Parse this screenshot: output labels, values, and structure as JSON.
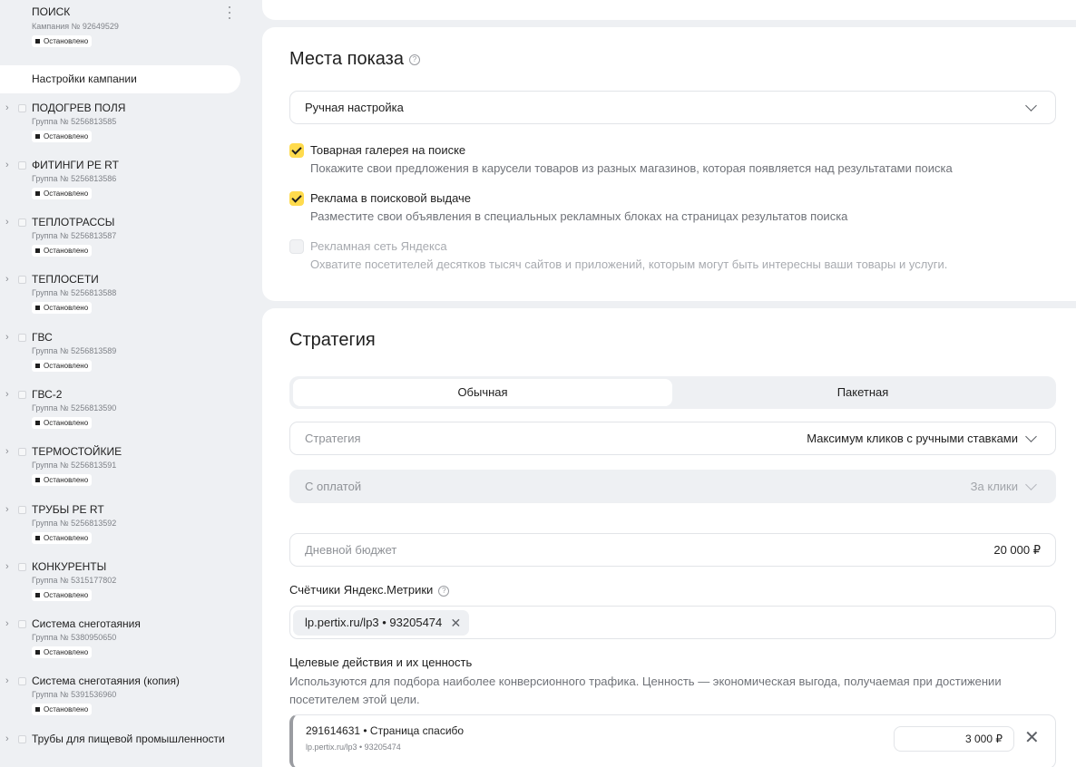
{
  "sidebar": {
    "campaign": {
      "title": "ПОИСК",
      "subtitle": "Кампания № 92649529",
      "status": "Остановлено"
    },
    "settings_label": "Настройки кампании",
    "groups": [
      {
        "title": "ПОДОГРЕВ ПОЛЯ",
        "subtitle": "Группа № 5256813585",
        "status": "Остановлено"
      },
      {
        "title": "ФИТИНГИ PE RT",
        "subtitle": "Группа № 5256813586",
        "status": "Остановлено"
      },
      {
        "title": "ТЕПЛОТРАССЫ",
        "subtitle": "Группа № 5256813587",
        "status": "Остановлено"
      },
      {
        "title": "ТЕПЛОСЕТИ",
        "subtitle": "Группа № 5256813588",
        "status": "Остановлено"
      },
      {
        "title": "ГВС",
        "subtitle": "Группа № 5256813589",
        "status": "Остановлено"
      },
      {
        "title": "ГВС-2",
        "subtitle": "Группа № 5256813590",
        "status": "Остановлено"
      },
      {
        "title": "ТЕРМОСТОЙКИЕ",
        "subtitle": "Группа № 5256813591",
        "status": "Остановлено"
      },
      {
        "title": "ТРУБЫ PE RT",
        "subtitle": "Группа № 5256813592",
        "status": "Остановлено"
      },
      {
        "title": "КОНКУРЕНТЫ",
        "subtitle": "Группа № 5315177802",
        "status": "Остановлено"
      },
      {
        "title": "Система снеготаяния",
        "subtitle": "Группа № 5380950650",
        "status": "Остановлено"
      },
      {
        "title": "Система снеготаяния (копия)",
        "subtitle": "Группа № 5391536960",
        "status": "Остановлено"
      },
      {
        "title": "Трубы для пищевой промышленности",
        "subtitle": "",
        "status": ""
      }
    ]
  },
  "places": {
    "title": "Места показа",
    "mode_select": "Ручная настройка",
    "options": [
      {
        "label": "Товарная галерея на поиске",
        "desc": "Покажите свои предложения в карусели товаров из разных магазинов, которая появляется над результатами поиска",
        "checked": true
      },
      {
        "label": "Реклама в поисковой выдаче",
        "desc": "Разместите свои объявления в специальных рекламных блоках на страницах результатов поиска",
        "checked": true
      },
      {
        "label": "Рекламная сеть Яндекса",
        "desc": "Охватите посетителей десятков тысяч сайтов и приложений, которым могут быть интересны ваши товары и услуги.",
        "checked": false,
        "disabled": true
      }
    ]
  },
  "strategy": {
    "title": "Стратегия",
    "tabs": [
      "Обычная",
      "Пакетная"
    ],
    "strategy_label": "Стратегия",
    "strategy_value": "Максимум кликов с ручными ставками",
    "payment_label": "С оплатой",
    "payment_value": "За клики",
    "budget_label": "Дневной бюджет",
    "budget_value": "20 000 ₽",
    "metrika_label": "Счётчики Яндекс.Метрики",
    "metrika_tag": "lp.pertix.ru/lp3 • 93205474",
    "goals_title": "Целевые действия и их ценность",
    "goals_desc": "Используются для подбора наиболее конверсионного трафика. Ценность — экономическая выгода, получаемая при достижении посетителем этой цели.",
    "goal": {
      "title": "291614631 • Страница спасибо",
      "sub": "lp.pertix.ru/lp3 • 93205474",
      "value": "3 000 ₽"
    }
  },
  "icons": {
    "help": "question-circle-icon",
    "chevron": "chevron-down-icon",
    "close": "close-icon",
    "expand": "chevron-right-icon",
    "more": "kebab-menu-icon"
  }
}
